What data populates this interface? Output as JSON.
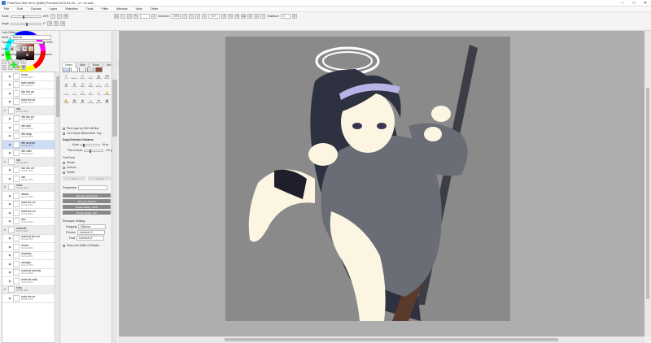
{
  "window": {
    "title": "PaintTool SAI Ver.2 (64bit) Preview.2023.04.05 - ui / 14.sai2"
  },
  "menu": [
    "File",
    "Edit",
    "Canvas",
    "Layer",
    "Selection",
    "Tools",
    "Filter",
    "Window",
    "View",
    "Other"
  ],
  "toolbar": {
    "size_label": "Scale",
    "size_value": "25%",
    "angle_label": "Angle",
    "angle_value": "0°",
    "selection_label": "Selection",
    "selection_value": "25%",
    "zoom_value": "0.0°",
    "stabilizer_label": "Stabilizer",
    "stabilizer_value": "3"
  },
  "colors": {
    "accent": "#cfdcf5",
    "swatch_main": "#8b4a3a",
    "artboard_bg": "#8a8a8a"
  },
  "left_panel": {
    "lock_effect": "Lock Effect",
    "mode_label": "Mode",
    "mode_value": "Normal",
    "opacity_label": "Opacity",
    "opacity_value": "100%",
    "lock_label": "Lock",
    "clipping_label": "Clipping Group",
    "selection_source_label": "Selection Source",
    "layers": [
      {
        "name": "frame",
        "sub": "Normal 100%",
        "folder": false
      },
      {
        "name": "eyes sketch",
        "sub": "Normal 100%",
        "folder": false
      },
      {
        "name": "hair line art",
        "sub": "Normal 100%",
        "folder": false
      },
      {
        "name": "body line art",
        "sub": "Multiply 100%",
        "folder": false
      },
      {
        "name": "hair",
        "sub": "Normal 100%",
        "folder": true
      },
      {
        "name": "rifle line art",
        "sub": "Normal 100%",
        "folder": false
      },
      {
        "name": "rifle side",
        "sub": "Normal 100%",
        "folder": false
      },
      {
        "name": "rifle strap",
        "sub": "Normal 100%",
        "folder": false
      },
      {
        "name": "rifle accents",
        "sub": "Normal 100%",
        "folder": false
      },
      {
        "name": "rifle main",
        "sub": "Normal 100%",
        "folder": false
      },
      {
        "name": "hair",
        "sub": "Normal 100%",
        "folder": true
      },
      {
        "name": "hair line art",
        "sub": "Normal 100%",
        "folder": false
      },
      {
        "name": "hair",
        "sub": "Normal 100%",
        "folder": false
      },
      {
        "name": "head",
        "sub": "Normal 100%",
        "folder": true
      },
      {
        "name": "details",
        "sub": "Normal 100%",
        "folder": false
      },
      {
        "name": "head line art",
        "sub": "Normal 100%",
        "folder": false
      },
      {
        "name": "head line art",
        "sub": "Normal 100%",
        "folder": false
      },
      {
        "name": "skin",
        "sub": "Normal 100%",
        "folder": false
      },
      {
        "name": "swimsuit",
        "sub": "Normal 100%",
        "folder": true
      },
      {
        "name": "swimsuit line art",
        "sub": "Normal 100%",
        "folder": false
      },
      {
        "name": "shines",
        "sub": "Normal 100%",
        "folder": false
      },
      {
        "name": "shadows",
        "sub": "Normal 100%",
        "folder": false
      },
      {
        "name": "cardigan",
        "sub": "Normal 100%",
        "folder": false
      },
      {
        "name": "swimsuit accents",
        "sub": "Normal 100%",
        "folder": false
      },
      {
        "name": "swimsuit main",
        "sub": "Normal 100%",
        "folder": false
      },
      {
        "name": "body",
        "sub": "Normal 100%",
        "folder": true
      },
      {
        "name": "body line art",
        "sub": "Normal 100%",
        "folder": false
      }
    ]
  },
  "tool_panel": {
    "tabs": [
      "Select",
      "Main",
      "Bruss",
      "Ver.1",
      "Brille"
    ],
    "tools": [
      "Pen",
      "Airbrush",
      "Brush",
      "Water",
      "Marker",
      "Eraser",
      "Blur",
      "Crown",
      "Fabric",
      "Outline",
      "Blender",
      "Pencil",
      "Scatter",
      "Gauge",
      "Binder",
      "Blend",
      "Pick",
      "Smudge",
      "Crayon",
      "Stencil",
      "Spider",
      "Shading",
      "Bucket",
      "Grad."
    ],
    "pick_layer_label": "Pick Layer by Ctrl+LMClick",
    "lcl_move_label": "Lcl & Move without Mod. Key",
    "drag_title": "Drag Detection Distance",
    "move_label": "Move",
    "move_value": "+8 px",
    "pick_move_label": "Pick & Move",
    "pick_move_value": "+20 px",
    "free_label": "FreeTrans",
    "resize_label": "Resize",
    "uniform_label": "Uniform",
    "rotate_label": "Rotate",
    "ok_label": "OK",
    "cancel_label": "Cancel",
    "perspective_label": "Perspective",
    "reverse_h": "Reverse Horizontal",
    "reverse_v": "Reverse Vertical",
    "rotate_90_ccw": "Rotate 90deg. CCW",
    "rotate_90_cw": "Rotate 90deg. CW",
    "resample_title": "Resample Settings",
    "dragging_label": "Dragging",
    "dragging_value": "Bilinear",
    "preview_label": "Preview",
    "preview_value": "Lanczos 3",
    "final_label": "Final",
    "final_value": "Lanczos 3",
    "keep_line_label": "Keep Line Width of Shapes"
  }
}
